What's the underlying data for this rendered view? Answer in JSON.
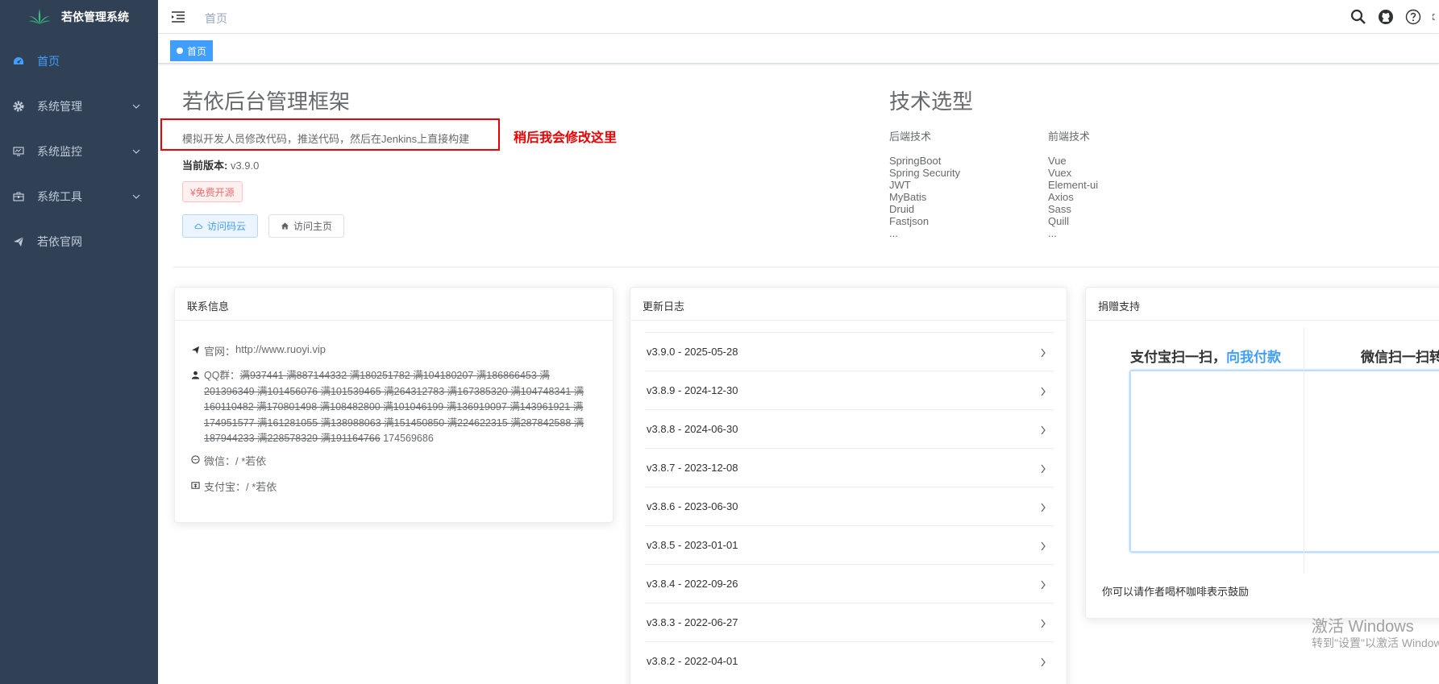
{
  "app": {
    "title": "若依管理系统"
  },
  "sidebar": {
    "items": [
      {
        "label": "首页",
        "icon": "dashboard-icon",
        "active": true
      },
      {
        "label": "系统管理",
        "icon": "gear-icon"
      },
      {
        "label": "系统监控",
        "icon": "monitor-icon"
      },
      {
        "label": "系统工具",
        "icon": "toolbox-icon"
      },
      {
        "label": "若依官网",
        "icon": "paper-plane-icon"
      }
    ]
  },
  "navbar": {
    "breadcrumb": "首页",
    "icons": [
      "search-icon",
      "github-icon",
      "question-icon",
      "fullscreen-icon"
    ]
  },
  "tags": {
    "active": "首页"
  },
  "intro": {
    "title": "若依后台管理框架",
    "desc": "模拟开发人员修改代码，推送代码，然后在Jenkins上直接构建",
    "annotation": "稍后我会修改这里",
    "version_label": "当前版本:",
    "version": " v3.9.0",
    "free_tag": "¥免费开源",
    "btn_gitee": "访问码云",
    "btn_home": "访问主页"
  },
  "tech": {
    "title": "技术选型",
    "backend_title": "后端技术",
    "frontend_title": "前端技术",
    "backend": [
      "SpringBoot",
      "Spring Security",
      "JWT",
      "MyBatis",
      "Druid",
      "Fastjson",
      "..."
    ],
    "frontend": [
      "Vue",
      "Vuex",
      "Element-ui",
      "Axios",
      "Sass",
      "Quill",
      "..."
    ]
  },
  "contact": {
    "header": "联系信息",
    "site_label": "官网：",
    "site_url": "http://www.ruoyi.vip",
    "qq_label": "QQ群：",
    "qq_full": [
      "满937441",
      "满887144332",
      "满180251782",
      "满104180207",
      "满186866453",
      "满201396349",
      "满101456076",
      "满101539465",
      "满264312783",
      "满167385320",
      "满104748341",
      "满160110482",
      "满170801498",
      "满108482800",
      "满101046199",
      "满136919097",
      "满143961921",
      "满174951577",
      "满161281055",
      "满138988063",
      "满151450850",
      "满224622315",
      "满287842588",
      "满187944233",
      "满228578329",
      "满191164766"
    ],
    "qq_active": "174569686",
    "wechat_label": "微信：",
    "wechat": "/ *若依",
    "alipay_label": "支付宝：",
    "alipay": "/ *若依"
  },
  "changelog": {
    "header": "更新日志",
    "items": [
      "v3.9.0 - 2025-05-28",
      "v3.8.9 - 2024-12-30",
      "v3.8.8 - 2024-06-30",
      "v3.8.7 - 2023-12-08",
      "v3.8.6 - 2023-06-30",
      "v3.8.5 - 2023-01-01",
      "v3.8.4 - 2022-09-26",
      "v3.8.3 - 2022-06-27",
      "v3.8.2 - 2022-04-01"
    ]
  },
  "donate": {
    "header": "捐赠支持",
    "alipay_title_a": "支付宝扫一扫，",
    "alipay_title_b": "向我付款",
    "wechat_title": "微信扫一扫转",
    "footer": "你可以请作者喝杯咖啡表示鼓励"
  },
  "watermark": {
    "line1": "激活 Windows",
    "line2": "转到\"设置\"以激活 Windows。"
  },
  "colors": {
    "sidebar_bg": "#304156",
    "accent": "#409eff",
    "annotation": "#ee0000"
  }
}
